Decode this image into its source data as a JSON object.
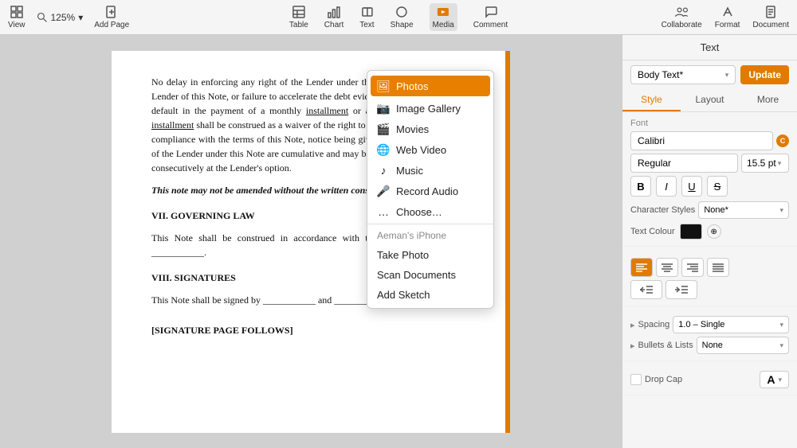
{
  "toolbar": {
    "view_label": "View",
    "zoom_value": "125%",
    "add_page_label": "Add Page",
    "table_label": "Table",
    "chart_label": "Chart",
    "text_label": "Text",
    "shape_label": "Shape",
    "media_label": "Media",
    "comment_label": "Comment",
    "collaborate_label": "Collaborate",
    "format_label": "Format",
    "document_label": "Document"
  },
  "dropdown": {
    "photos": "Photos",
    "image_gallery": "Image Gallery",
    "movies": "Movies",
    "web_video": "Web Video",
    "music": "Music",
    "record_audio": "Record Audio",
    "choose": "Choose…",
    "device_header": "Aeman's iPhone",
    "take_photo": "Take Photo",
    "scan_documents": "Scan Documents",
    "add_sketch": "Add Sketch"
  },
  "document": {
    "para1": "No delay in enforcing any right of the Lender under this Note, or assignment by Lender of this Note, or failure to accelerate the debt evidenced hereby by reason of default in the payment of a monthly installment or acceptance of a past-due installment shall be construed as a waiver of the right to thereafter insist upon strict compliance with the terms of this Note, notice being given to Borrower. All rights of the Lender under this Note are cumulative and may be exercised concurrently or consecutively at the Lender's option.",
    "para2": "This note may not be amended without the written consent of the holder.",
    "section7_title": "VII. GOVERNING LAW",
    "section7_body": "This Note shall be construed in accordance with the laws of the State of ___________.",
    "section8_title": "VIII. SIGNATURES",
    "section8_body": "This Note shall be signed by ___________ and ___________.",
    "signature_block": "[SIGNATURE PAGE FOLLOWS]"
  },
  "right_panel": {
    "header": "Text",
    "style_name": "Body Text*",
    "update_label": "Update",
    "tab_style": "Style",
    "tab_layout": "Layout",
    "tab_more": "More",
    "font_label": "Font",
    "font_name": "Calibri",
    "font_style": "Regular",
    "font_size": "15.5 pt",
    "bold": "B",
    "italic": "I",
    "underline": "U",
    "strikethrough": "S",
    "char_styles_label": "Character Styles",
    "char_styles_value": "None*",
    "text_color_label": "Text Colour",
    "align_left": "≡",
    "align_center": "≡",
    "align_right": "≡",
    "align_justify": "≡",
    "spacing_label": "Spacing",
    "spacing_value": "1.0 – Single",
    "bullets_label": "Bullets & Lists",
    "bullets_value": "None",
    "dropcap_label": "Drop Cap"
  }
}
